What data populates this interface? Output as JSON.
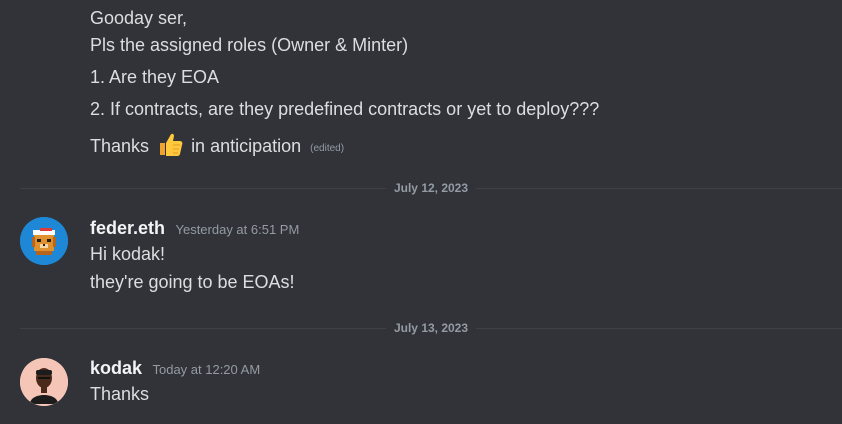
{
  "first_message": {
    "lines": [
      "Gooday ser,",
      "Pls the assigned roles (Owner & Minter)",
      "1. Are they EOA",
      "2. If contracts, are they predefined contracts or yet to deploy???"
    ],
    "thanks_before": "Thanks",
    "thanks_emoji": "thumbs-up-emoji",
    "thanks_after": "in anticipation",
    "edited_label": "(edited)"
  },
  "dividers": [
    {
      "date": "July 12, 2023"
    },
    {
      "date": "July 13, 2023"
    }
  ],
  "messages": [
    {
      "username": "feder.eth",
      "timestamp": "Yesterday at 6:51 PM",
      "avatar": "pixel-lion-avatar",
      "lines": [
        "Hi kodak!",
        "they're going to be EOAs!"
      ]
    },
    {
      "username": "kodak",
      "timestamp": "Today at 12:20 AM",
      "avatar": "person-avatar",
      "lines": [
        "Thanks"
      ]
    }
  ],
  "colors": {
    "background": "#313338",
    "text": "#dbdee1",
    "muted": "#949ba4",
    "username": "#f2f3f5",
    "feder_avatar_bg": "#1e88d6",
    "kodak_avatar_bg": "#f5c6b8"
  }
}
